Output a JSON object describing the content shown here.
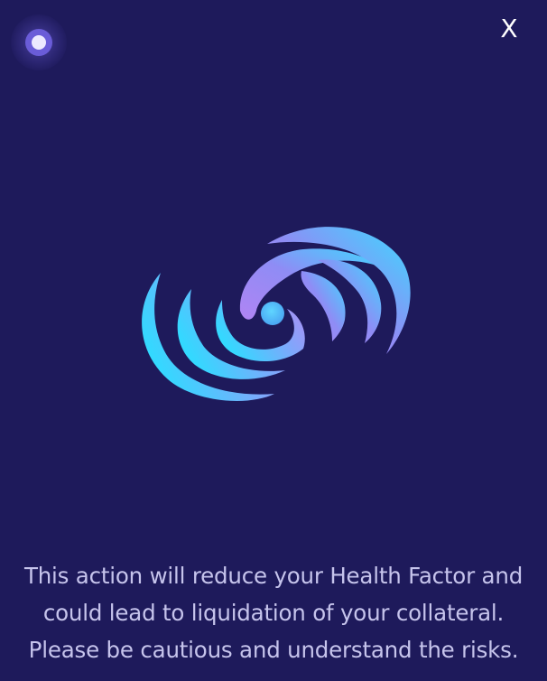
{
  "status_indicator": {
    "icon": "status-dot-icon",
    "color": "#6a5cd8"
  },
  "close_button": {
    "label": "X"
  },
  "logo": {
    "icon": "swirl-logo-icon",
    "colors": [
      "#33d6ff",
      "#8f8cf5",
      "#b58cf5"
    ]
  },
  "warning": {
    "lines": [
      "This action will reduce your Health Factor and",
      "could lead to liquidation of your collateral.",
      "Please be cautious and understand the risks."
    ]
  },
  "colors": {
    "background": "#1e1a5b",
    "text": "#c6c4ec"
  }
}
